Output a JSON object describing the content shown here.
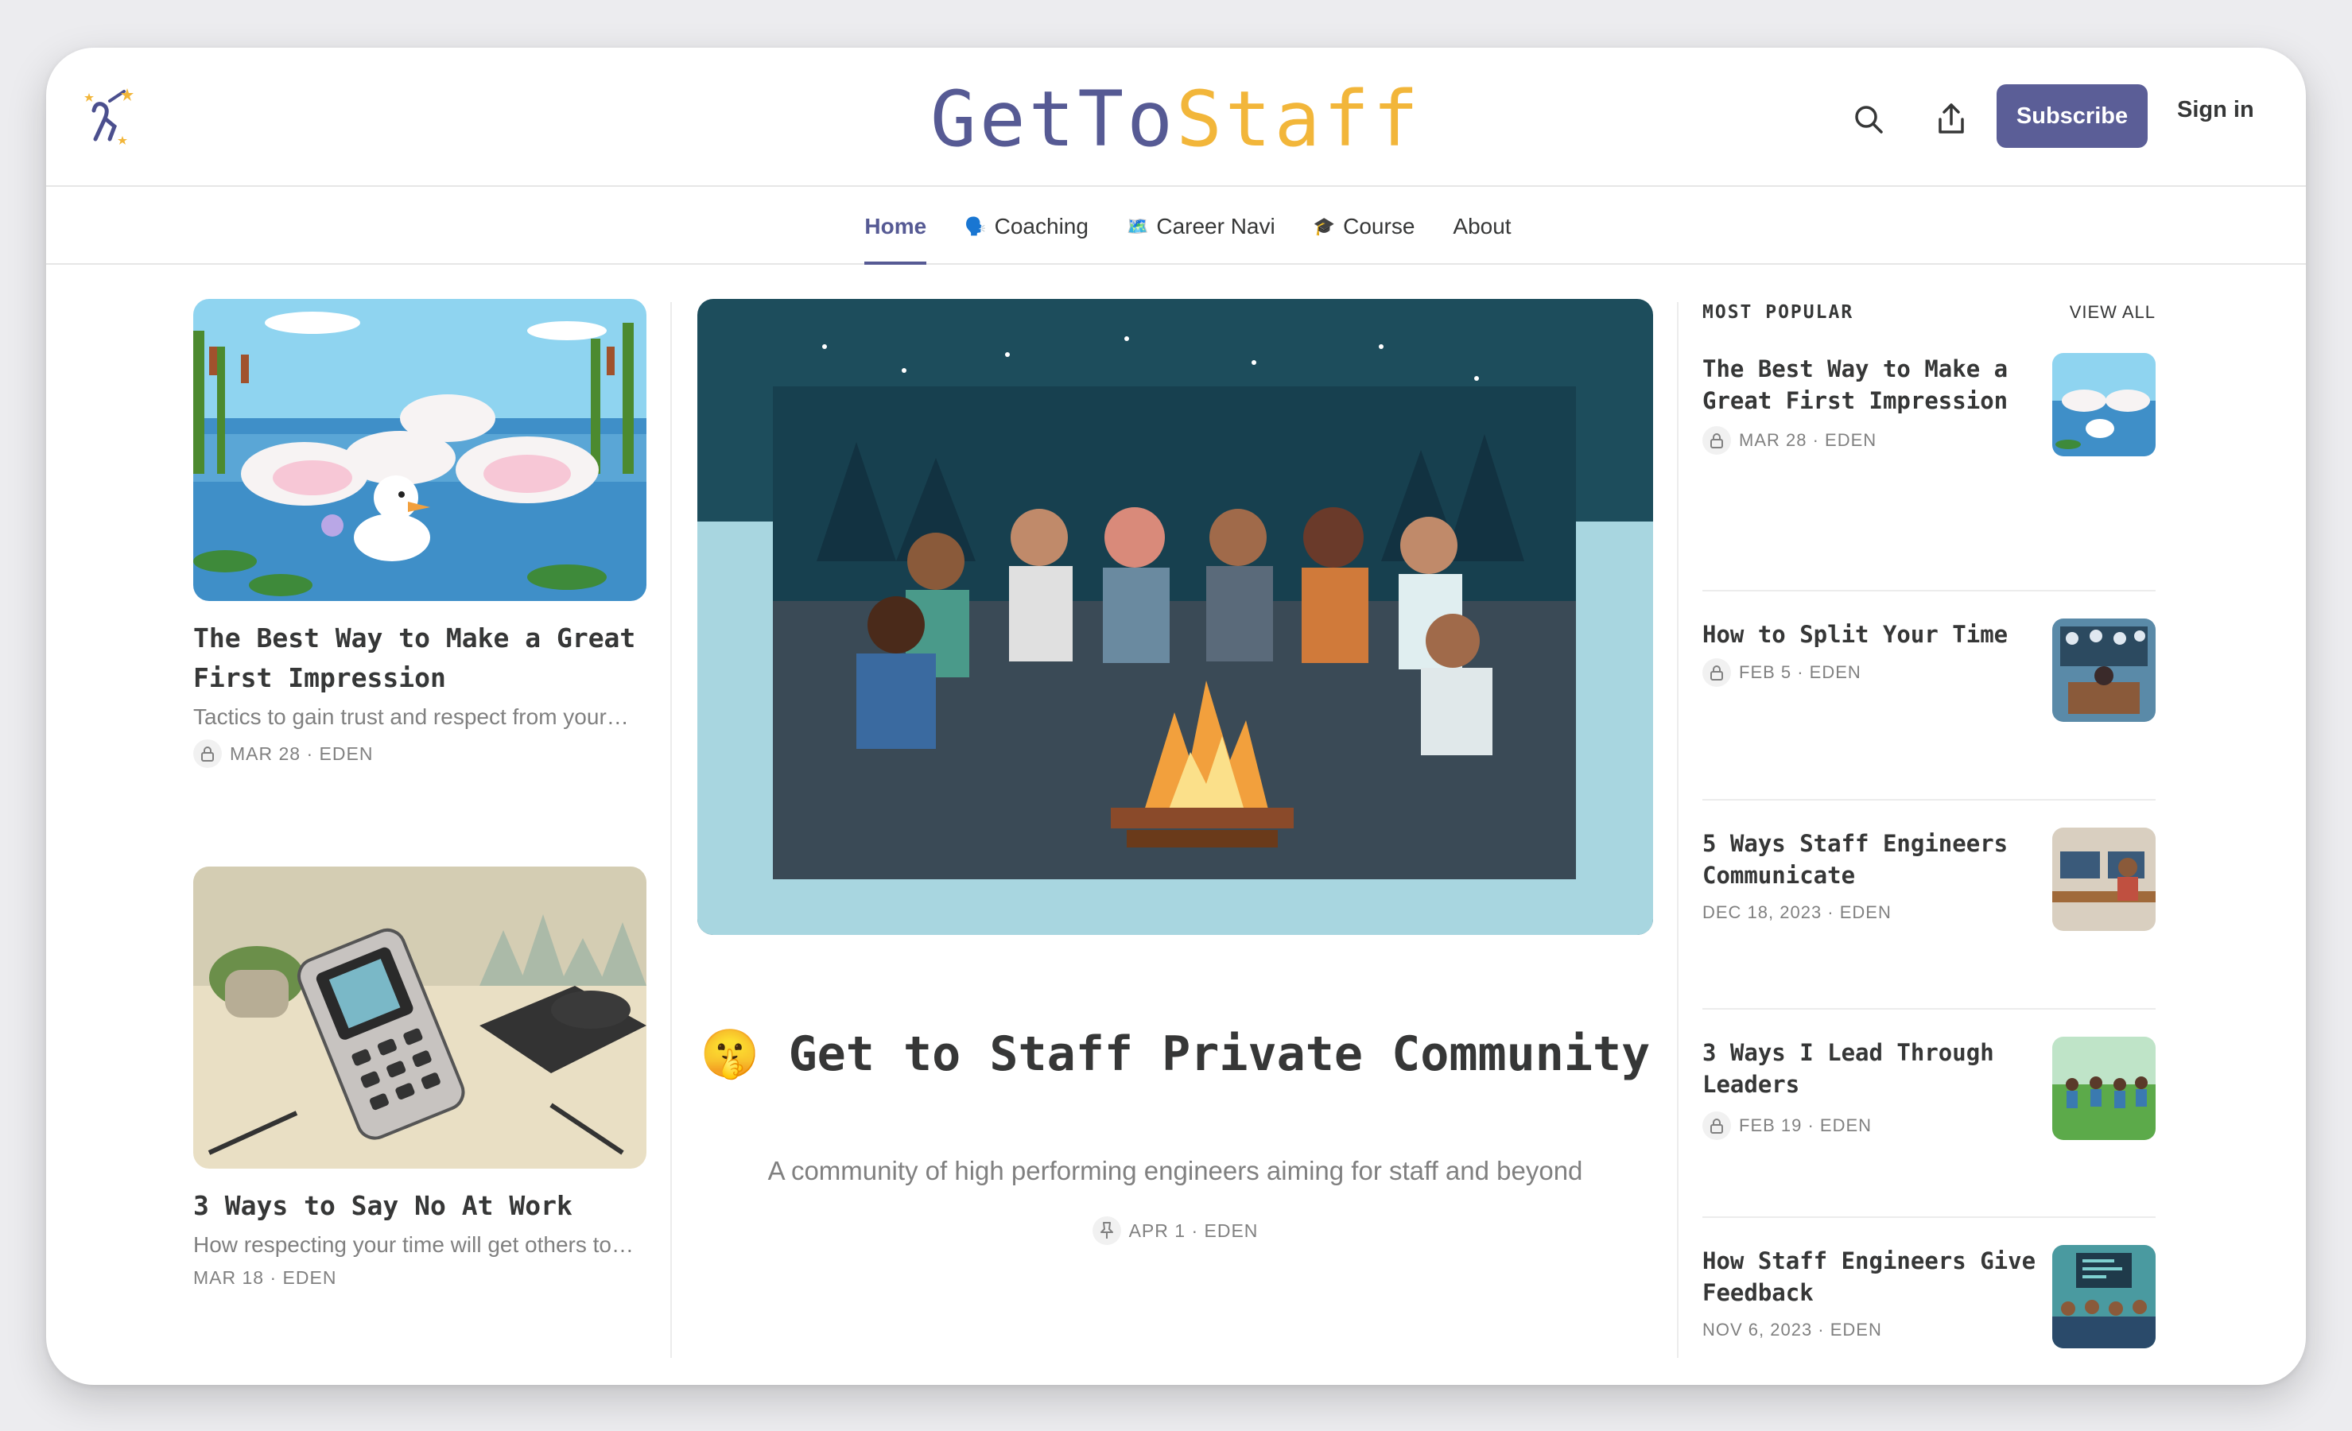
{
  "header": {
    "brand_part1": "GetTo",
    "brand_part2": "Staff",
    "subscribe_label": "Subscribe",
    "signin_label": "Sign in",
    "colors": {
      "brand_primary": "#565a94",
      "brand_accent": "#f2b63a",
      "subscribe_bg": "#5b5e97"
    }
  },
  "nav": {
    "items": [
      {
        "label": "Home",
        "emoji": ""
      },
      {
        "label": "Coaching",
        "emoji": "🗣️"
      },
      {
        "label": "Career Navi",
        "emoji": "🗺️"
      },
      {
        "label": "Course",
        "emoji": "🎓"
      },
      {
        "label": "About",
        "emoji": ""
      }
    ]
  },
  "left_posts": [
    {
      "title": "The Best Way to Make a Great First Impression",
      "subtitle": "Tactics to gain trust and respect from your…",
      "meta": "MAR 28 · EDEN",
      "locked": true
    },
    {
      "title": "3 Ways to Say No At Work",
      "subtitle": "How respecting your time will get others to…",
      "meta": "MAR 18 · EDEN",
      "locked": false
    }
  ],
  "featured": {
    "emoji": "🤫",
    "title": "Get to Staff Private Community",
    "subtitle": "A community of high performing engineers aiming for staff and beyond",
    "meta": "APR 1 · EDEN",
    "pinned": true
  },
  "popular": {
    "heading": "MOST POPULAR",
    "view_all": "VIEW ALL",
    "items": [
      {
        "title": "The Best Way to Make a Great First Impression",
        "meta": "MAR 28 · EDEN",
        "locked": true
      },
      {
        "title": "How to Split Your Time",
        "meta": "FEB 5 · EDEN",
        "locked": true
      },
      {
        "title": "5 Ways Staff Engineers Communicate",
        "meta": "DEC 18, 2023 · EDEN",
        "locked": false
      },
      {
        "title": "3 Ways I Lead Through Leaders",
        "meta": "FEB 19 · EDEN",
        "locked": true
      },
      {
        "title": "How Staff Engineers Give Feedback",
        "meta": "NOV 6, 2023 · EDEN",
        "locked": false
      }
    ]
  }
}
